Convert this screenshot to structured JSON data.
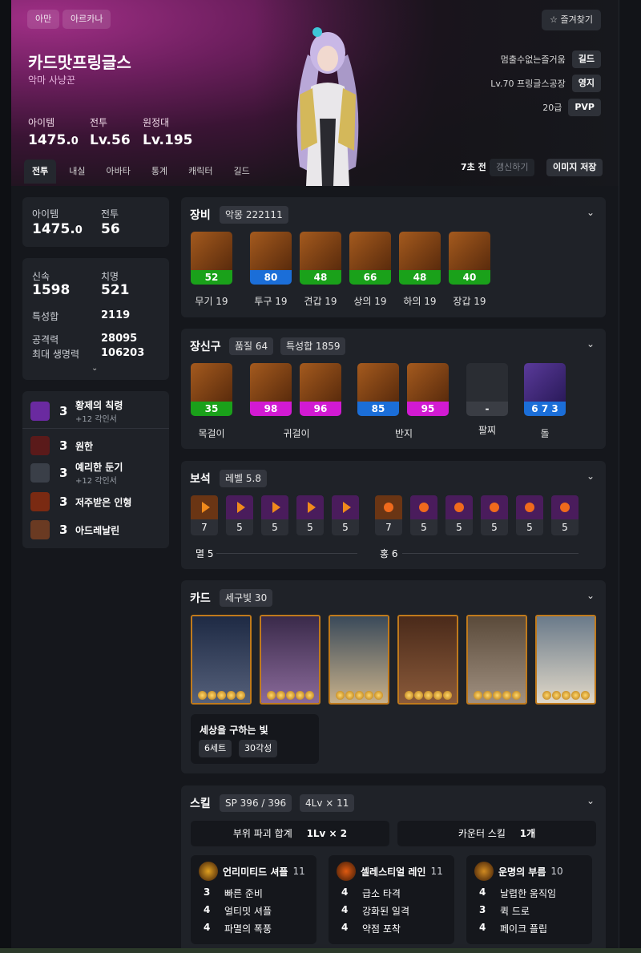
{
  "header": {
    "server": "아만",
    "region": "아르카나",
    "favorite_label": "즐겨찾기",
    "name": "카드맛프링글스",
    "class": "악마 사냥꾼",
    "stats": [
      {
        "label": "아이템",
        "value": "1475.",
        "suffix": "0"
      },
      {
        "label": "전투",
        "value": "Lv.56",
        "suffix": ""
      },
      {
        "label": "원정대",
        "value": "Lv.195",
        "suffix": ""
      }
    ],
    "guild": {
      "label": "멈출수없는즐거움",
      "tag": "길드"
    },
    "estate": {
      "label": "Lv.70 프링글스공장",
      "tag": "영지"
    },
    "pvp": {
      "label": "20급",
      "tag": "PVP"
    },
    "tabs": [
      "전투",
      "내실",
      "아바타",
      "통계",
      "캐릭터",
      "길드"
    ],
    "updated": "7초 전",
    "refresh_label": "갱신하기",
    "save_image_label": "이미지 저장"
  },
  "left": {
    "summary": {
      "item_label": "아이템",
      "item_value": "1475.",
      "item_suffix": "0",
      "combat_label": "전투",
      "combat_value": "56"
    },
    "stats": {
      "swift_label": "신속",
      "swift_value": "1598",
      "crit_label": "치명",
      "crit_value": "521",
      "total_label": "특성합",
      "total_value": "2119",
      "atk_label": "공격력",
      "atk_value": "28095",
      "hp_label": "최대 생명력",
      "hp_value": "106203"
    },
    "engravings": [
      {
        "level": "3",
        "name": "황제의 칙령",
        "sub": "+12 각인서",
        "color": "#6a2aa0"
      },
      {
        "level": "3",
        "name": "원한",
        "sub": "",
        "color": "#5a1a1a"
      },
      {
        "level": "3",
        "name": "예리한 둔기",
        "sub": "+12 각인서",
        "color": "#3a3f48"
      },
      {
        "level": "3",
        "name": "저주받은 인형",
        "sub": "",
        "color": "#7a2a12"
      },
      {
        "level": "3",
        "name": "아드레날린",
        "sub": "",
        "color": "#6a3a22"
      }
    ]
  },
  "equipment": {
    "title": "장비",
    "set": "악몽 222111",
    "items": [
      {
        "quality": "52",
        "label": "무기 19",
        "bar": "#1aa11a"
      },
      {
        "quality": "80",
        "label": "투구 19",
        "bar": "#1b6ed8"
      },
      {
        "quality": "48",
        "label": "견갑 19",
        "bar": "#1aa11a"
      },
      {
        "quality": "66",
        "label": "상의 19",
        "bar": "#1aa11a"
      },
      {
        "quality": "48",
        "label": "하의 19",
        "bar": "#1aa11a"
      },
      {
        "quality": "40",
        "label": "장갑 19",
        "bar": "#1aa11a"
      }
    ]
  },
  "accessories": {
    "title": "장신구",
    "quality": "품질 64",
    "stat_total": "특성합 1859",
    "items": [
      {
        "quality": "35",
        "bar": "#1aa11a"
      },
      {
        "quality": "98",
        "bar": "#d21ad2"
      },
      {
        "quality": "96",
        "bar": "#d21ad2"
      },
      {
        "quality": "85",
        "bar": "#1b6ed8"
      },
      {
        "quality": "95",
        "bar": "#d21ad2"
      },
      {
        "quality": "-",
        "bar": "#3a3d44"
      },
      {
        "quality": "6 7 3",
        "bar": "#1b6ed8"
      }
    ],
    "labels": [
      "목걸이",
      "귀걸이",
      "반지",
      "팔찌",
      "돌"
    ]
  },
  "gems": {
    "title": "보석",
    "level": "레벨 5.8",
    "group1_levels": [
      "7",
      "5",
      "5",
      "5",
      "5"
    ],
    "group2_levels": [
      "7",
      "5",
      "5",
      "5",
      "5",
      "5"
    ],
    "group1_label": "멸 5",
    "group2_label": "홍 6"
  },
  "cards": {
    "title": "카드",
    "set": "세구빛 30",
    "set_name": "세상을 구하는 빛",
    "tags": [
      "6세트",
      "30각성"
    ]
  },
  "skills": {
    "title": "스킬",
    "sp": "SP 396 / 396",
    "lv": "4Lv × 11",
    "destroy_label": "부위 파괴 합계",
    "destroy_value": "1Lv × 2",
    "counter_label": "카운터 스킬",
    "counter_value": "1개",
    "list": [
      {
        "name": "언리미티드 셔플",
        "count": "11",
        "color": "#e0a020",
        "tripods": [
          {
            "n": "3",
            "t": "빠른 준비"
          },
          {
            "n": "4",
            "t": "얼티밋 셔플"
          },
          {
            "n": "4",
            "t": "파멸의 폭풍"
          }
        ]
      },
      {
        "name": "셀레스티얼 레인",
        "count": "11",
        "color": "#e05a10",
        "tripods": [
          {
            "n": "4",
            "t": "급소 타격"
          },
          {
            "n": "4",
            "t": "강화된 일격"
          },
          {
            "n": "4",
            "t": "약점 포착"
          }
        ]
      },
      {
        "name": "운명의 부름",
        "count": "10",
        "color": "#d08a20",
        "tripods": [
          {
            "n": "4",
            "t": "날렵한 움직임"
          },
          {
            "n": "3",
            "t": "퀵 드로"
          },
          {
            "n": "4",
            "t": "페이크 플립"
          }
        ]
      }
    ]
  }
}
